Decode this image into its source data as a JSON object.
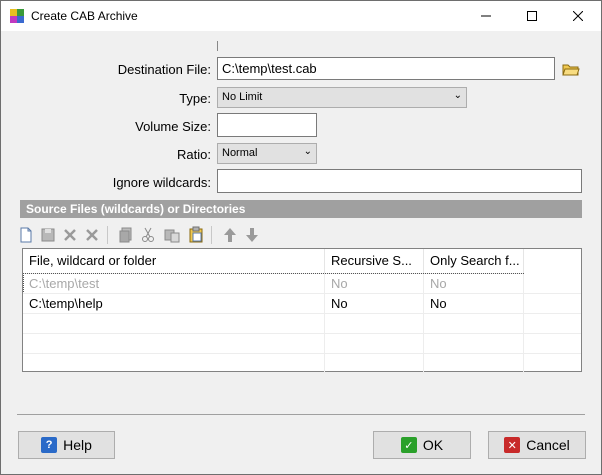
{
  "window": {
    "title": "Create CAB Archive"
  },
  "form": {
    "destination_label": "Destination File:",
    "destination_value": "C:\\temp\\test.cab",
    "type_label": "Type:",
    "type_value": "No Limit",
    "volume_label": "Volume Size:",
    "volume_value": "",
    "ratio_label": "Ratio:",
    "ratio_value": "Normal",
    "ignore_label": "Ignore wildcards:",
    "ignore_value": ""
  },
  "section": {
    "title": "Source Files (wildcards) or Directories"
  },
  "table": {
    "headers": [
      "File, wildcard or folder",
      "Recursive S...",
      "Only Search f..."
    ],
    "rows": [
      {
        "path": "C:\\temp\\test",
        "recursive": "No",
        "only": "No"
      },
      {
        "path": "C:\\temp\\help",
        "recursive": "No",
        "only": "No"
      }
    ]
  },
  "buttons": {
    "help": "Help",
    "ok": "OK",
    "cancel": "Cancel"
  }
}
